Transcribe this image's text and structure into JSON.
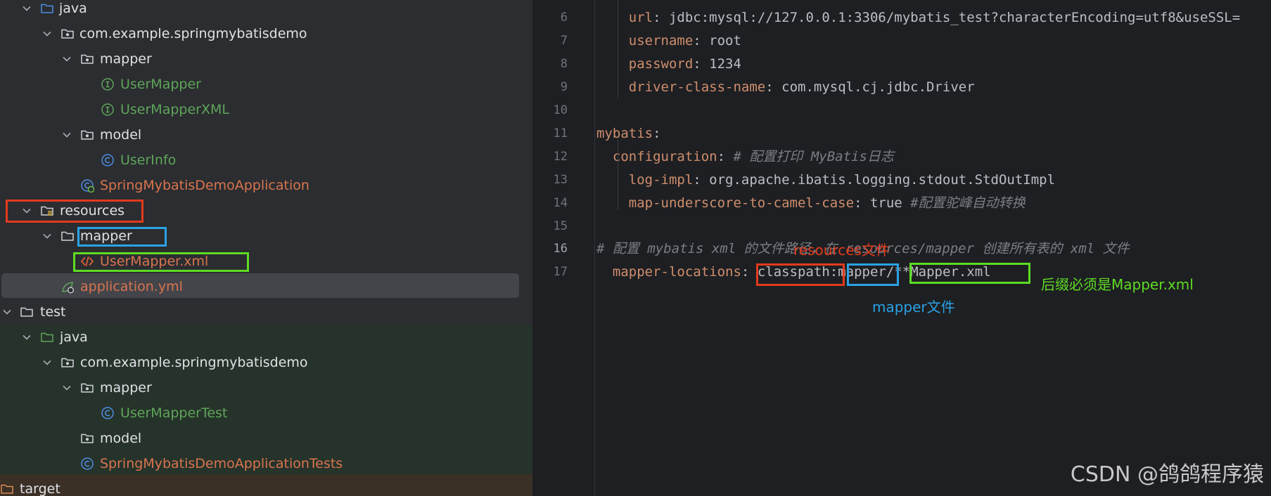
{
  "colors": {
    "annotation_red": "#e23a1e",
    "annotation_blue": "#29a3e6",
    "annotation_green": "#5ddc23"
  },
  "project_tree": [
    {
      "label": "java",
      "icon": "source-folder-icon",
      "expanded": true,
      "color": "default"
    },
    {
      "label": "com.example.springmybatisdemo",
      "icon": "package-icon",
      "expanded": true,
      "color": "default"
    },
    {
      "label": "mapper",
      "icon": "package-icon",
      "expanded": true,
      "color": "default"
    },
    {
      "label": "UserMapper",
      "icon": "interface-icon",
      "color": "green"
    },
    {
      "label": "UserMapperXML",
      "icon": "interface-icon",
      "color": "green"
    },
    {
      "label": "model",
      "icon": "package-icon",
      "expanded": true,
      "color": "default"
    },
    {
      "label": "UserInfo",
      "icon": "class-icon",
      "color": "green"
    },
    {
      "label": "SpringMybatisDemoApplication",
      "icon": "spring-class-icon",
      "color": "orange"
    },
    {
      "label": "resources",
      "icon": "resources-folder-icon",
      "expanded": true,
      "color": "default"
    },
    {
      "label": "mapper",
      "icon": "folder-icon",
      "expanded": true,
      "color": "default"
    },
    {
      "label": "UserMapper.xml",
      "icon": "xml-file-icon",
      "color": "orange"
    },
    {
      "label": "application.yml",
      "icon": "yaml-file-icon",
      "color": "orange",
      "selected": true
    },
    {
      "label": "test",
      "icon": "folder-icon",
      "expanded": true,
      "color": "default"
    },
    {
      "label": "java",
      "icon": "test-folder-icon",
      "expanded": true,
      "color": "default"
    },
    {
      "label": "com.example.springmybatisdemo",
      "icon": "package-icon",
      "expanded": true,
      "color": "default"
    },
    {
      "label": "mapper",
      "icon": "package-icon",
      "expanded": true,
      "color": "default"
    },
    {
      "label": "UserMapperTest",
      "icon": "class-icon",
      "color": "green"
    },
    {
      "label": "model",
      "icon": "package-icon",
      "color": "default"
    },
    {
      "label": "SpringMybatisDemoApplicationTests",
      "icon": "class-icon",
      "color": "orange"
    },
    {
      "label": "target",
      "icon": "excluded-folder-icon",
      "color": "default"
    }
  ],
  "editor": {
    "current_line": "16",
    "lines": [
      {
        "num": "6",
        "key": "url",
        "value": "jdbc:mysql://127.0.0.1:3306/mybatis_test?characterEncoding=utf8&useSSL="
      },
      {
        "num": "7",
        "key": "username",
        "value": "root"
      },
      {
        "num": "8",
        "key": "password",
        "value": "1234"
      },
      {
        "num": "9",
        "key": "driver-class-name",
        "value": "com.mysql.cj.jdbc.Driver"
      },
      {
        "num": "10"
      },
      {
        "num": "11",
        "key": "mybatis",
        "value": ""
      },
      {
        "num": "12",
        "key": "configuration",
        "comment": "# 配置打印 MyBatis日志"
      },
      {
        "num": "13",
        "key": "log-impl",
        "value": "org.apache.ibatis.logging.stdout.StdOutImpl"
      },
      {
        "num": "14",
        "key": "map-underscore-to-camel-case",
        "value": "true",
        "comment": "#配置驼峰自动转换"
      },
      {
        "num": "15"
      },
      {
        "num": "16",
        "comment": "# 配置 mybatis xml 的文件路径，在 resources/mapper 创建所有表的 xml 文件"
      },
      {
        "num": "17",
        "key": "mapper-locations",
        "value_parts": [
          "classpath",
          ":",
          "mapper",
          "/",
          "**Mapper.xml"
        ]
      }
    ]
  },
  "annotations": {
    "resources_note": "resources文件",
    "mapper_note": "mapper文件",
    "suffix_note": "后缀必须是Mapper.xml"
  },
  "watermark": "CSDN @鸽鸽程序猿"
}
